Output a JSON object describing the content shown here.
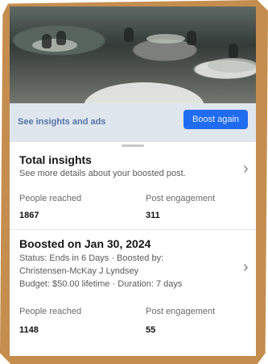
{
  "banner": {
    "link": "See insights and ads",
    "boost_button": "Boost again"
  },
  "total_insights": {
    "title": "Total insights",
    "subtitle": "See more details about your boosted post.",
    "people_reached_label": "People reached",
    "people_reached_value": "1867",
    "engagement_label": "Post engagement",
    "engagement_value": "311"
  },
  "boosted": {
    "title": "Boosted on Jan 30, 2024",
    "status_line1": "Status: Ends in 6 Days · Boosted by:",
    "status_line2": "Christensen-McKay J Lyndsey",
    "status_line3": "Budget: $50.00 lifetime · Duration: 7 days",
    "people_reached_label": "People reached",
    "people_reached_value": "1148",
    "engagement_label": "Post engagement",
    "engagement_value": "55"
  },
  "icons": {
    "chevron": "chevron-right-icon"
  },
  "colors": {
    "accent": "#1f6cf0",
    "frame": "#c58d4e"
  }
}
